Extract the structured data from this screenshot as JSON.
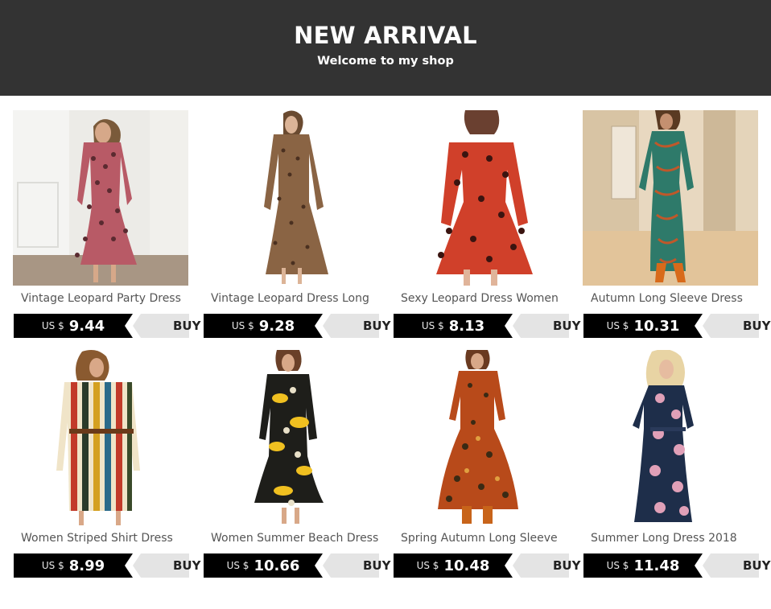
{
  "header": {
    "title": "NEW ARRIVAL",
    "subtitle": "Welcome to my shop"
  },
  "colors": {
    "header_bg": "#333333",
    "price_bg": "#000000",
    "buy_bg": "#e4e4e4"
  },
  "products": [
    {
      "name": "Vintage Leopard Party Dress",
      "currency": "US $",
      "price": "9.44",
      "buy": "BUY",
      "image": "leopard-pink-dress-photo"
    },
    {
      "name": "Vintage Leopard Dress Long",
      "currency": "US $",
      "price": "9.28",
      "buy": "BUY",
      "image": "leopard-brown-dress-photo"
    },
    {
      "name": "Sexy Leopard Dress Women",
      "currency": "US $",
      "price": "8.13",
      "buy": "BUY",
      "image": "leopard-red-dress-photo"
    },
    {
      "name": "Autumn Long Sleeve Dress",
      "currency": "US $",
      "price": "10.31",
      "buy": "BUY",
      "image": "green-print-dress-photo"
    },
    {
      "name": "Women Striped Shirt Dress",
      "currency": "US $",
      "price": "8.99",
      "buy": "BUY",
      "image": "striped-shirt-dress-photo"
    },
    {
      "name": "Women Summer Beach Dress",
      "currency": "US $",
      "price": "10.66",
      "buy": "BUY",
      "image": "floral-black-yellow-dress-photo"
    },
    {
      "name": "Spring Autumn Long Sleeve",
      "currency": "US $",
      "price": "10.48",
      "buy": "BUY",
      "image": "orange-print-dress-photo"
    },
    {
      "name": "Summer Long Dress 2018",
      "currency": "US $",
      "price": "11.48",
      "buy": "BUY",
      "image": "navy-floral-maxi-dress-photo"
    }
  ]
}
